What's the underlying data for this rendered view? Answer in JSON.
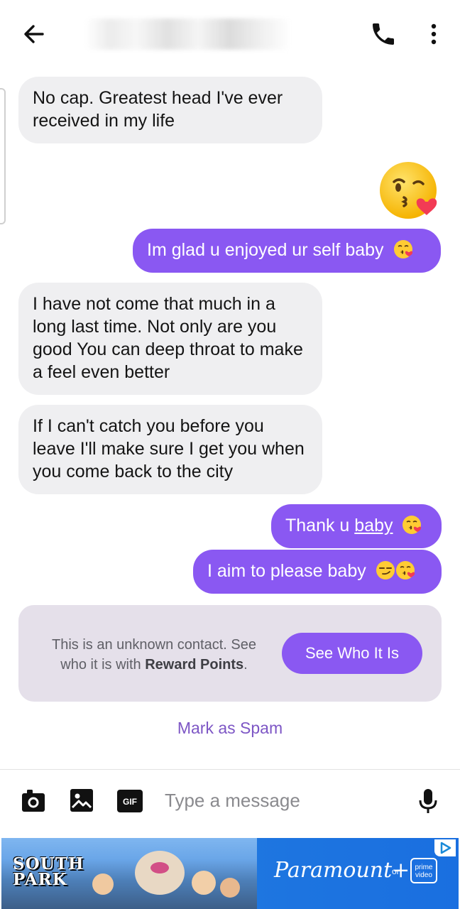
{
  "header": {
    "back_icon": "arrow-left-icon",
    "call_icon": "phone-icon",
    "menu_icon": "more-vertical-icon"
  },
  "messages": [
    {
      "direction": "incoming",
      "text": "No cap. Greatest head I've ever received in my life"
    },
    {
      "direction": "outgoing",
      "emoji": "face-blowing-a-kiss"
    },
    {
      "direction": "outgoing",
      "text": "Im glad u enjoyed ur self baby",
      "emoji": "face-blowing-a-kiss"
    },
    {
      "direction": "incoming",
      "text": "I have not come that much in a long last time. Not only are you good You can deep throat to make a feel even better"
    },
    {
      "direction": "incoming",
      "text": "If I can't catch you before you leave I'll make sure I get you when you come back to the city"
    },
    {
      "direction": "outgoing",
      "text_plain": "Thank u ",
      "text_link": "baby",
      "emoji": "face-blowing-a-kiss"
    },
    {
      "direction": "outgoing",
      "text": "I aim to please baby",
      "emoji": "smirking-face face-blowing-a-kiss"
    }
  ],
  "unknown_contact": {
    "text_before": "This is an unknown contact. See who it is with ",
    "text_bold": "Reward Points",
    "text_after": ".",
    "button_label": "See Who It Is"
  },
  "mark_spam_label": "Mark as Spam",
  "composer": {
    "placeholder": "Type a message",
    "gif_label": "GIF",
    "icons": [
      "camera-icon",
      "image-icon",
      "gif-icon",
      "microphone-icon"
    ]
  },
  "ad": {
    "south_park_line1": "SOUTH",
    "south_park_line2": "PARK",
    "paramount_label": "Paramount+",
    "on_label": "on",
    "prime_line1": "prime",
    "prime_line2": "video",
    "colors": {
      "background": "#1d86e6"
    }
  },
  "colors": {
    "accent": "#8a58f2",
    "incoming_bubble": "#efeff1",
    "card": "#e5e0ea",
    "spam_link": "#7d56c5"
  }
}
